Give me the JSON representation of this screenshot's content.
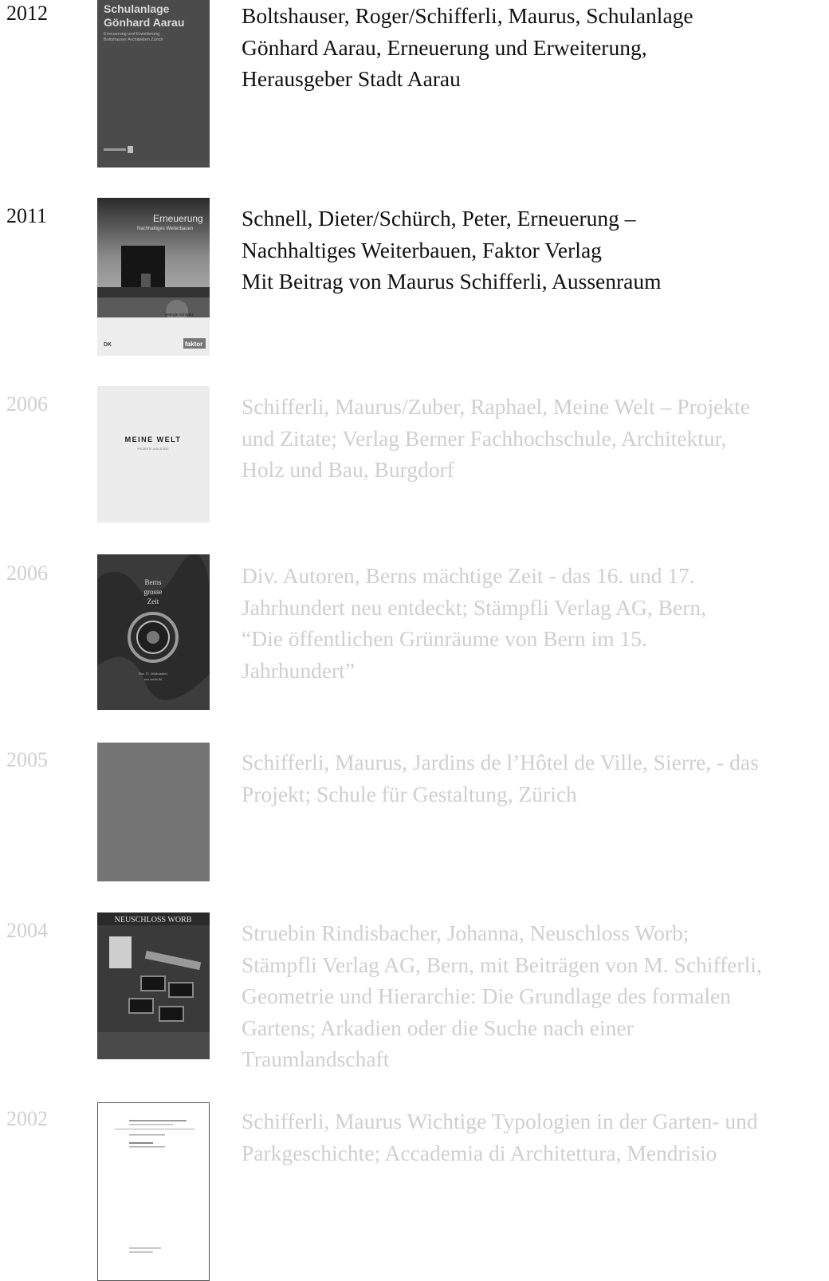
{
  "entries": [
    {
      "year": "2012",
      "text": "Boltshauser, Roger/Schifferli, Maurus, Schulanlage\nGönhard Aarau, Erneuerung und Erweiterung,\nHerausgeber Stadt Aarau",
      "cover": {
        "title_1": "Schulanlage",
        "title_2": "Gönhard Aarau",
        "sub_1": "Erneuerung und Erweiterung",
        "sub_2": "Boltshauser Architekten Zürich"
      }
    },
    {
      "year": "2011",
      "text": "Schnell, Dieter/Schürch, Peter, Erneuerung –\nNachhaltiges Weiterbauen, Faktor Verlag\nMit Beitrag von Maurus Schifferli, Aussenraum",
      "cover": {
        "title": "Erneuerung",
        "sub": "Nachhaltiges Weiterbauen",
        "badge": "energie schweiz",
        "logo_left": "DK",
        "logo_right": "faktor"
      }
    },
    {
      "year": "2006",
      "text": "Schifferli, Maurus/Zuber, Raphael, Meine Welt – Projekte\nund Zitate; Verlag Berner Fachhochschule, Architektur,\nHolz und Bau, Burgdorf",
      "cover": {
        "title": "MEINE WELT",
        "sub": "PROJEKTE UND ZITATE"
      }
    },
    {
      "year": "2006",
      "text": "Div. Autoren, Berns mächtige Zeit - das 16. und 17.\nJahrhundert neu entdeckt; Stämpfli Verlag AG, Bern,\n“Die öffentlichen Grünräume von Bern im 15.\nJahrhundert”",
      "cover": {
        "line_1": "Berns",
        "line_2": "grosse",
        "line_3": "Zeit",
        "foot_1": "Das 15. Jahrhundert",
        "foot_2": "neu entdeckt"
      }
    },
    {
      "year": "2005",
      "text": "Schifferli, Maurus, Jardins de l’Hôtel de Ville, Sierre, - das\nProjekt; Schule für Gestaltung, Zürich",
      "cover": {}
    },
    {
      "year": "2004",
      "text": "Struebin Rindisbacher, Johanna, Neuschloss Worb;\nStämpfli Verlag AG, Bern, mit Beiträgen von M. Schifferli,\nGeometrie  und Hierarchie: Die Grundlage des formalen\nGartens; Arkadien oder die Suche nach einer\nTraumlandschaft",
      "cover": {
        "title": "NEUSCHLOSS WORB"
      }
    },
    {
      "year": "2002",
      "text": "Schifferli, Maurus Wichtige Typologien in der Garten- und\nParkgeschichte; Accademia di Architettura, Mendrisio",
      "cover": {}
    }
  ],
  "colors": {
    "dark_text": "#111111",
    "light_text": "#cfcfcf"
  }
}
